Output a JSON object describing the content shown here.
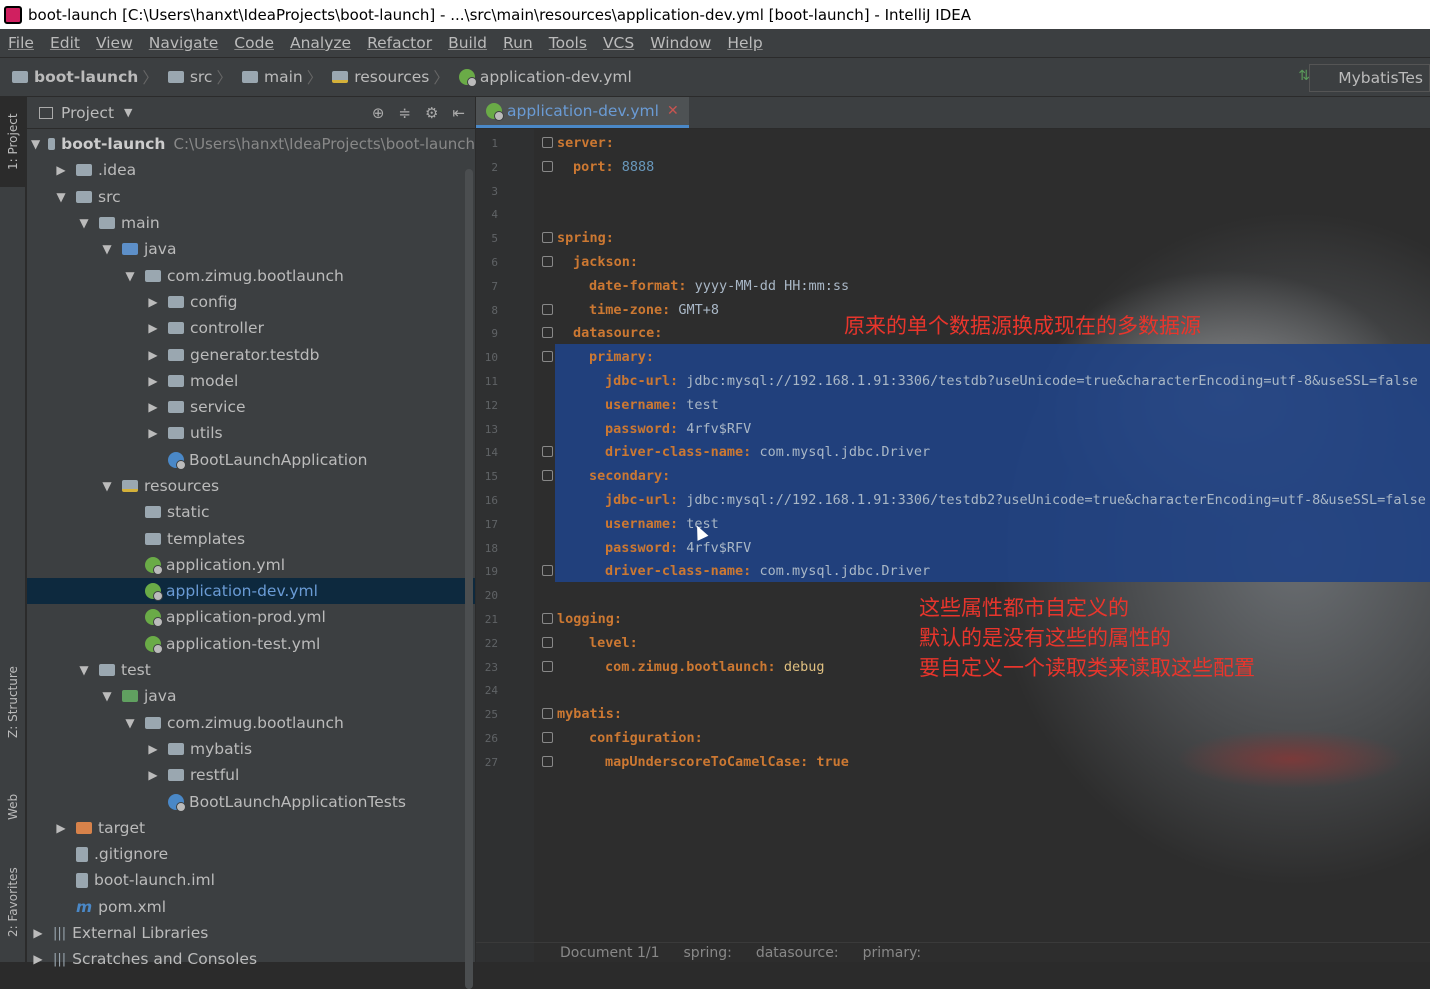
{
  "window": {
    "title": "boot-launch [C:\\Users\\hanxt\\IdeaProjects\\boot-launch] - ...\\src\\main\\resources\\application-dev.yml [boot-launch] - IntelliJ IDEA"
  },
  "menu": [
    "File",
    "Edit",
    "View",
    "Navigate",
    "Code",
    "Analyze",
    "Refactor",
    "Build",
    "Run",
    "Tools",
    "VCS",
    "Window",
    "Help"
  ],
  "breadcrumb": [
    "boot-launch",
    "src",
    "main",
    "resources",
    "application-dev.yml"
  ],
  "run_config": "MybatisTes",
  "side_tabs": {
    "project": "1: Project",
    "structure": "Z: Structure",
    "web": "Web",
    "favorites": "2: Favorites"
  },
  "project_panel": {
    "title": "Project",
    "root_name": "boot-launch",
    "root_path": "C:\\Users\\hanxt\\IdeaProjects\\boot-launch",
    "items": [
      {
        "label": ".idea",
        "arrow": "▶",
        "indent": 1,
        "icon": "folder"
      },
      {
        "label": "src",
        "arrow": "▼",
        "indent": 1,
        "icon": "folder"
      },
      {
        "label": "main",
        "arrow": "▼",
        "indent": 2,
        "icon": "folder"
      },
      {
        "label": "java",
        "arrow": "▼",
        "indent": 3,
        "icon": "src"
      },
      {
        "label": "com.zimug.bootlaunch",
        "arrow": "▼",
        "indent": 4,
        "icon": "folder"
      },
      {
        "label": "config",
        "arrow": "▶",
        "indent": 5,
        "icon": "folder"
      },
      {
        "label": "controller",
        "arrow": "▶",
        "indent": 5,
        "icon": "folder"
      },
      {
        "label": "generator.testdb",
        "arrow": "▶",
        "indent": 5,
        "icon": "folder"
      },
      {
        "label": "model",
        "arrow": "▶",
        "indent": 5,
        "icon": "folder"
      },
      {
        "label": "service",
        "arrow": "▶",
        "indent": 5,
        "icon": "folder"
      },
      {
        "label": "utils",
        "arrow": "▶",
        "indent": 5,
        "icon": "folder"
      },
      {
        "label": "BootLaunchApplication",
        "arrow": "",
        "indent": 5,
        "icon": "class"
      },
      {
        "label": "resources",
        "arrow": "▼",
        "indent": 3,
        "icon": "res"
      },
      {
        "label": "static",
        "arrow": "",
        "indent": 4,
        "icon": "folder"
      },
      {
        "label": "templates",
        "arrow": "",
        "indent": 4,
        "icon": "folder"
      },
      {
        "label": "application.yml",
        "arrow": "",
        "indent": 4,
        "icon": "yml"
      },
      {
        "label": "application-dev.yml",
        "arrow": "",
        "indent": 4,
        "icon": "yml",
        "selected": true
      },
      {
        "label": "application-prod.yml",
        "arrow": "",
        "indent": 4,
        "icon": "yml"
      },
      {
        "label": "application-test.yml",
        "arrow": "",
        "indent": 4,
        "icon": "yml"
      },
      {
        "label": "test",
        "arrow": "▼",
        "indent": 2,
        "icon": "folder"
      },
      {
        "label": "java",
        "arrow": "▼",
        "indent": 3,
        "icon": "green"
      },
      {
        "label": "com.zimug.bootlaunch",
        "arrow": "▼",
        "indent": 4,
        "icon": "folder"
      },
      {
        "label": "mybatis",
        "arrow": "▶",
        "indent": 5,
        "icon": "folder"
      },
      {
        "label": "restful",
        "arrow": "▶",
        "indent": 5,
        "icon": "folder"
      },
      {
        "label": "BootLaunchApplicationTests",
        "arrow": "",
        "indent": 5,
        "icon": "class"
      },
      {
        "label": "target",
        "arrow": "▶",
        "indent": 1,
        "icon": "orange"
      },
      {
        "label": ".gitignore",
        "arrow": "",
        "indent": 1,
        "icon": "file"
      },
      {
        "label": "boot-launch.iml",
        "arrow": "",
        "indent": 1,
        "icon": "file"
      },
      {
        "label": "pom.xml",
        "arrow": "",
        "indent": 1,
        "icon": "maven"
      },
      {
        "label": "External Libraries",
        "arrow": "▶",
        "indent": 0,
        "icon": "lib"
      },
      {
        "label": "Scratches and Consoles",
        "arrow": "▶",
        "indent": 0,
        "icon": "lib"
      }
    ]
  },
  "editor": {
    "tab": "application-dev.yml",
    "lines": [
      {
        "n": "1",
        "ind": 0,
        "key": "server:",
        "val": ""
      },
      {
        "n": "2",
        "ind": 2,
        "key": "port:",
        "val": " 8888",
        "num": true
      },
      {
        "n": "3",
        "ind": 0,
        "key": "",
        "val": ""
      },
      {
        "n": "4",
        "ind": 0,
        "key": "",
        "val": ""
      },
      {
        "n": "5",
        "ind": 0,
        "key": "spring:",
        "val": ""
      },
      {
        "n": "6",
        "ind": 2,
        "key": "jackson:",
        "val": ""
      },
      {
        "n": "7",
        "ind": 4,
        "key": "date-format:",
        "val": " yyyy-MM-dd HH:mm:ss"
      },
      {
        "n": "8",
        "ind": 4,
        "key": "time-zone:",
        "val": " GMT+8"
      },
      {
        "n": "9",
        "ind": 2,
        "key": "datasource:",
        "val": ""
      },
      {
        "n": "10",
        "ind": 4,
        "key": "primary:",
        "val": ""
      },
      {
        "n": "11",
        "ind": 6,
        "key": "jdbc-url:",
        "val": " jdbc:mysql://192.168.1.91:3306/testdb?useUnicode=true&characterEncoding=utf-8&useSSL=false"
      },
      {
        "n": "12",
        "ind": 6,
        "key": "username:",
        "val": " test"
      },
      {
        "n": "13",
        "ind": 6,
        "key": "password:",
        "val": " 4rfv$RFV"
      },
      {
        "n": "14",
        "ind": 6,
        "key": "driver-class-name:",
        "val": " com.mysql.jdbc.Driver"
      },
      {
        "n": "15",
        "ind": 4,
        "key": "secondary:",
        "val": ""
      },
      {
        "n": "16",
        "ind": 6,
        "key": "jdbc-url:",
        "val": " jdbc:mysql://192.168.1.91:3306/testdb2?useUnicode=true&characterEncoding=utf-8&useSSL=false"
      },
      {
        "n": "17",
        "ind": 6,
        "key": "username:",
        "val": " test"
      },
      {
        "n": "18",
        "ind": 6,
        "key": "password:",
        "val": " 4rfv$RFV"
      },
      {
        "n": "19",
        "ind": 6,
        "key": "driver-class-name:",
        "val": " com.mysql.jdbc.Driver"
      },
      {
        "n": "20",
        "ind": 0,
        "key": "",
        "val": ""
      },
      {
        "n": "21",
        "ind": 0,
        "key": "logging:",
        "val": ""
      },
      {
        "n": "22",
        "ind": 4,
        "key": "level:",
        "val": ""
      },
      {
        "n": "23",
        "ind": 6,
        "key": "com.zimug.bootlaunch:",
        "val": " debug",
        "orange": true
      },
      {
        "n": "24",
        "ind": 0,
        "key": "",
        "val": ""
      },
      {
        "n": "25",
        "ind": 0,
        "key": "mybatis:",
        "val": ""
      },
      {
        "n": "26",
        "ind": 4,
        "key": "configuration:",
        "val": ""
      },
      {
        "n": "27",
        "ind": 6,
        "key": "mapUnderscoreToCamelCase:",
        "val": " true",
        "bool": true
      }
    ],
    "annotation_1": "原来的单个数据源换成现在的多数据源",
    "annotation_2": [
      "这些属性都市自定义的",
      "默认的是没有这些的属性的",
      "要自定义一个读取类来读取这些配置"
    ],
    "status": [
      "Document 1/1",
      "spring:",
      "datasource:",
      "primary:"
    ]
  },
  "colors": {
    "key": "#cc7832",
    "number": "#6897bb",
    "selection": "#214283",
    "annotation": "#e8352c"
  }
}
